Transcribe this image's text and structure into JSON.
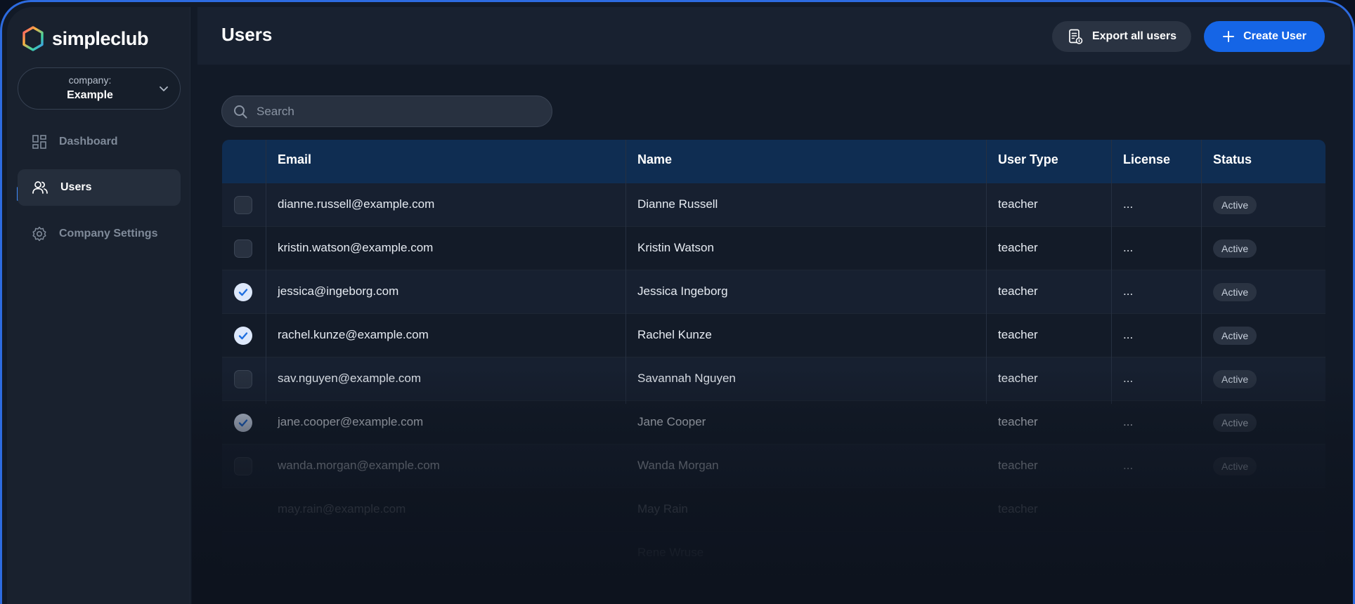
{
  "brand": {
    "name": "simpleclub"
  },
  "company": {
    "label": "company:",
    "value": "Example"
  },
  "sidebar": {
    "items": [
      {
        "label": "Dashboard",
        "icon": "grid-icon",
        "active": false
      },
      {
        "label": "Users",
        "icon": "users-icon",
        "active": true
      },
      {
        "label": "Company Settings",
        "icon": "gear-icon",
        "active": false
      }
    ]
  },
  "header": {
    "title": "Users",
    "export_label": "Export all users",
    "create_label": "Create User"
  },
  "search": {
    "placeholder": "Search",
    "value": ""
  },
  "table": {
    "columns": [
      "Email",
      "Name",
      "User Type",
      "License",
      "Status"
    ],
    "rows": [
      {
        "checked": false,
        "email": "dianne.russell@example.com",
        "name": "Dianne Russell",
        "type": "teacher",
        "license": "...",
        "status": "Active"
      },
      {
        "checked": false,
        "email": "kristin.watson@example.com",
        "name": "Kristin Watson",
        "type": "teacher",
        "license": "...",
        "status": "Active"
      },
      {
        "checked": true,
        "email": "jessica@ingeborg.com",
        "name": "Jessica Ingeborg",
        "type": "teacher",
        "license": "...",
        "status": "Active"
      },
      {
        "checked": true,
        "email": "rachel.kunze@example.com",
        "name": "Rachel Kunze",
        "type": "teacher",
        "license": "...",
        "status": "Active"
      },
      {
        "checked": false,
        "email": "sav.nguyen@example.com",
        "name": "Savannah Nguyen",
        "type": "teacher",
        "license": "...",
        "status": "Active"
      },
      {
        "checked": true,
        "email": "jane.cooper@example.com",
        "name": "Jane Cooper",
        "type": "teacher",
        "license": "...",
        "status": "Active"
      },
      {
        "checked": false,
        "email": "wanda.morgan@example.com",
        "name": "Wanda Morgan",
        "type": "teacher",
        "license": "...",
        "status": "Active"
      },
      {
        "checked": false,
        "email": "may.rain@example.com",
        "name": "May Rain",
        "type": "teacher",
        "license": "",
        "status": ""
      },
      {
        "checked": false,
        "email": "",
        "name": "Rene Wruse",
        "type": "",
        "license": "",
        "status": ""
      }
    ]
  },
  "colors": {
    "accent": "#1565e6",
    "header_row": "#0f2d52",
    "background": "#121a27"
  }
}
